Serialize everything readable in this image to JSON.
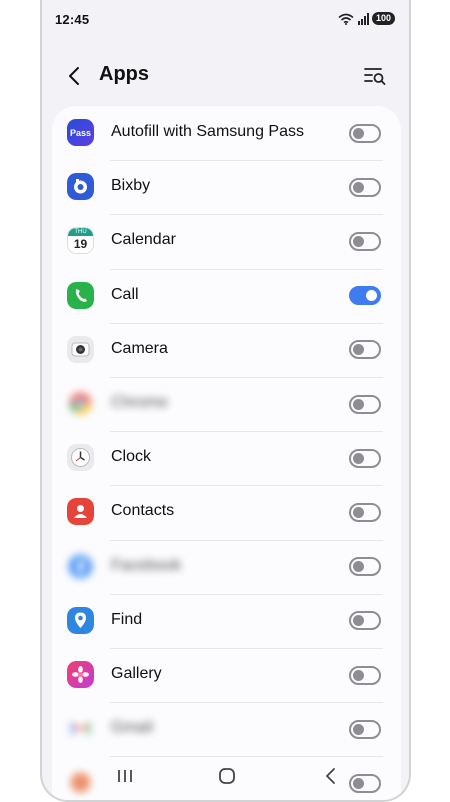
{
  "status_bar": {
    "time": "12:45",
    "battery": "100",
    "wifi_badge": "6"
  },
  "header": {
    "title": "Apps"
  },
  "apps": [
    {
      "label": "Autofill with Samsung Pass",
      "icon": "samsung-pass-icon",
      "icon_text": "Pass",
      "enabled": false,
      "blurred": false
    },
    {
      "label": "Bixby",
      "icon": "bixby-icon",
      "enabled": false,
      "blurred": false
    },
    {
      "label": "Calendar",
      "icon": "calendar-icon",
      "icon_text": "19",
      "icon_sub": "THU",
      "enabled": false,
      "blurred": false
    },
    {
      "label": "Call",
      "icon": "phone-icon",
      "enabled": true,
      "blurred": false
    },
    {
      "label": "Camera",
      "icon": "camera-icon",
      "enabled": false,
      "blurred": false
    },
    {
      "label": "Chrome",
      "icon": "chrome-icon",
      "enabled": false,
      "blurred": true
    },
    {
      "label": "Clock",
      "icon": "clock-icon",
      "enabled": false,
      "blurred": false
    },
    {
      "label": "Contacts",
      "icon": "contacts-icon",
      "enabled": false,
      "blurred": false
    },
    {
      "label": "Facebook",
      "icon": "facebook-icon",
      "enabled": false,
      "blurred": true
    },
    {
      "label": "Find",
      "icon": "find-icon",
      "enabled": false,
      "blurred": false
    },
    {
      "label": "Gallery",
      "icon": "gallery-icon",
      "enabled": false,
      "blurred": false
    },
    {
      "label": "Gmail",
      "icon": "gmail-icon",
      "enabled": false,
      "blurred": true
    },
    {
      "label": "",
      "icon": "app-icon",
      "enabled": false,
      "blurred": true
    }
  ],
  "colors": {
    "toggle_on": "#3e7cf0",
    "toggle_off": "#8d8d92",
    "background": "#f3f2f7"
  }
}
